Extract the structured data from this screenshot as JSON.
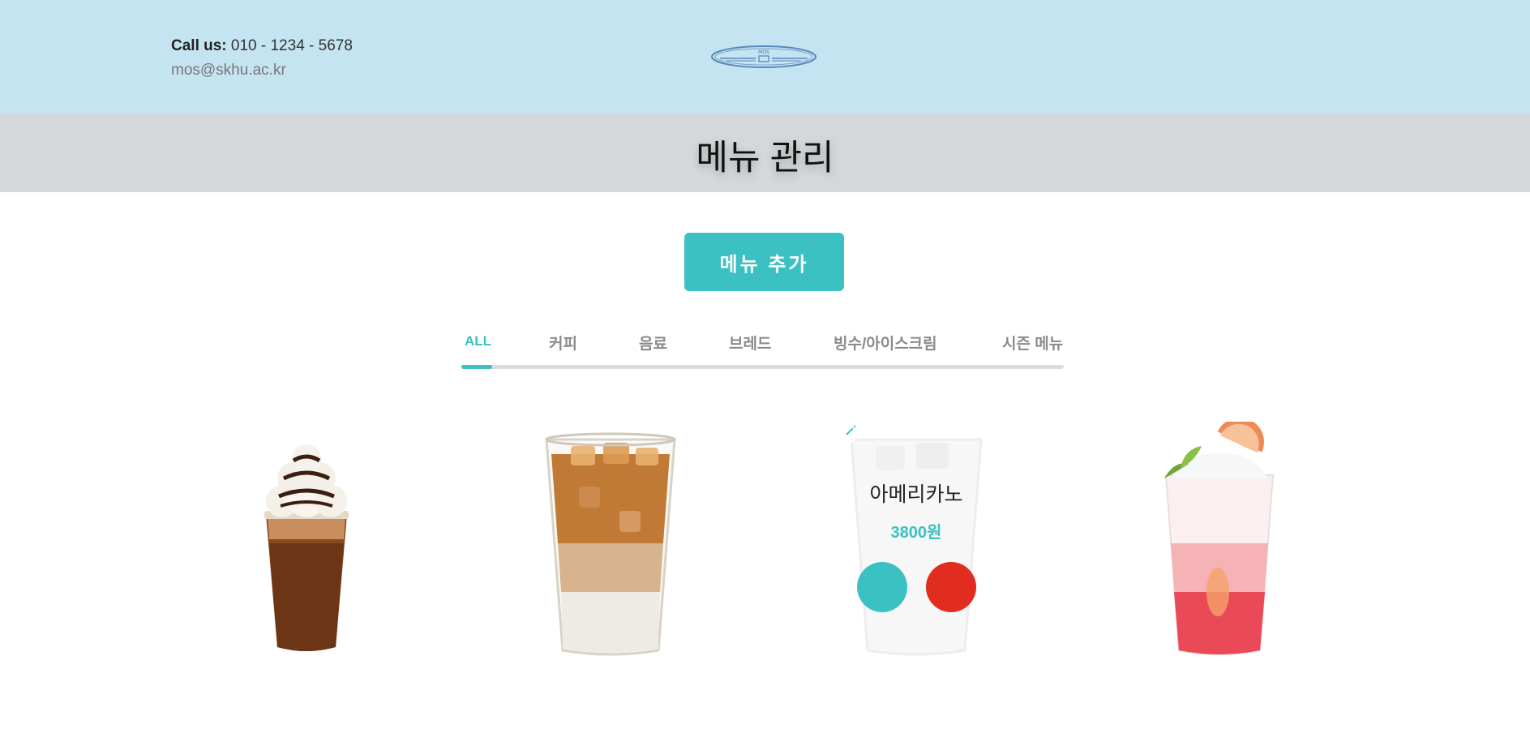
{
  "header": {
    "call_label": "Call us:",
    "phone": "010 - 1234 - 5678",
    "email": "mos@skhu.ac.kr",
    "logo_text": "MOS",
    "background_color": "#c5e4f2"
  },
  "title_bar": {
    "title": "메뉴 관리",
    "background_color": "#d5d8da"
  },
  "add_button": {
    "label": "메뉴 추가",
    "color": "#3cc1c2"
  },
  "tabs": [
    {
      "label": "ALL",
      "active": true
    },
    {
      "label": "커피",
      "active": false
    },
    {
      "label": "음료",
      "active": false
    },
    {
      "label": "브레드",
      "active": false
    },
    {
      "label": "빙수/아이스크림",
      "active": false
    },
    {
      "label": "시즌 메뉴",
      "active": false
    }
  ],
  "menu_items": [
    {
      "image": "chocolate-frappe-image"
    },
    {
      "image": "iced-latte-image"
    },
    {
      "image": "iced-americano-image",
      "name": "아메리카노",
      "price": "3800원",
      "hovered": true
    },
    {
      "image": "grapefruit-ade-image"
    }
  ],
  "actions": {
    "edit_icon": "edit-icon",
    "delete_icon": "close-icon",
    "edit_color": "#3cc1c2",
    "delete_color": "#e02d1f"
  }
}
